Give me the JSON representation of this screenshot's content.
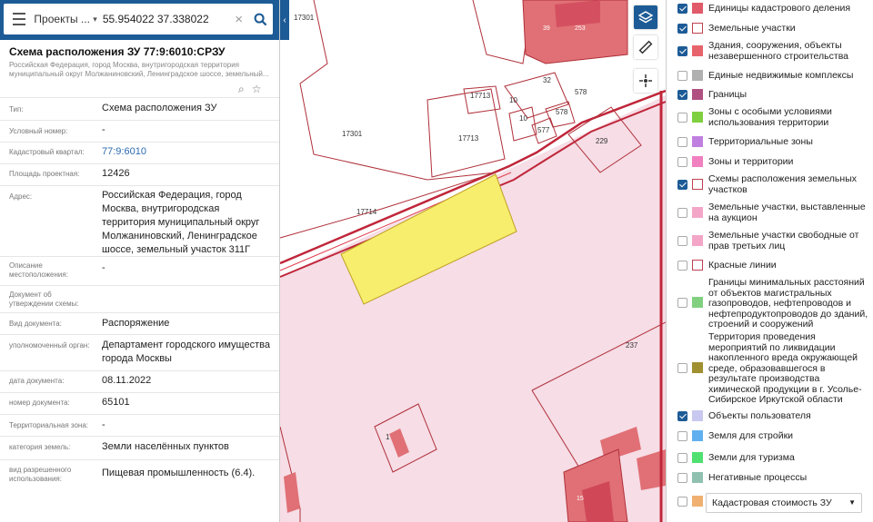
{
  "search": {
    "mode": "Проекты ...",
    "query": "55.954022 37.338022"
  },
  "card": {
    "title": "Схема расположения ЗУ 77:9:6010:СРЗУ",
    "address_sub": "Российская Федерация, город Москва, внутригородская территория муниципальный округ Молжаниновский, Ленинградское шоссе, земельный...",
    "rows": [
      {
        "label": "Тип:",
        "value": "Схема расположения ЗУ"
      },
      {
        "label": "Условный номер:",
        "value": "-"
      },
      {
        "label": "Кадастровый квартал:",
        "value": "77:9:6010"
      },
      {
        "label": "Площадь проектная:",
        "value": "12426"
      },
      {
        "label": "Адрес:",
        "value": "Российская Федерация, город Москва, внутригородская территория муниципальный округ Молжаниновский, Ленинградское шоссе, земельный участок 311Г"
      },
      {
        "label": "Описание местоположения:",
        "value": "-"
      },
      {
        "label": "Документ об утверждении схемы:",
        "value": ""
      },
      {
        "label": "Вид документа:",
        "value": "Распоряжение"
      },
      {
        "label": "уполномоченный орган:",
        "value": "Департамент городского имущества города Москвы"
      },
      {
        "label": "дата документа:",
        "value": "08.11.2022"
      },
      {
        "label": "номер документа:",
        "value": "65101"
      },
      {
        "label": "Территориальная зона:",
        "value": "-"
      },
      {
        "label": "категория земель:",
        "value": "Земли населённых пунктов"
      },
      {
        "label": "вид разрешенного использования:",
        "value": "Пищевая промышленность (6.4)."
      }
    ]
  },
  "map": {
    "parcel_labels": [
      "17301",
      "17301",
      "17713",
      "17713",
      "17714",
      "10",
      "10",
      "32",
      "577",
      "578",
      "578",
      "229",
      "237",
      "39",
      "253",
      "1",
      "15"
    ]
  },
  "layers": [
    {
      "label": "Единицы кадастрового деления",
      "checked": true,
      "swatch": "#e05a6a"
    },
    {
      "label": "Земельные участки",
      "checked": true,
      "swatch": "#ffffff"
    },
    {
      "label": "Здания, сооружения, объекты незавершенного строительства",
      "checked": true,
      "swatch": "#e8646c"
    },
    {
      "label": "Единые недвижимые комплексы",
      "checked": false,
      "swatch": "#b0b0b0"
    },
    {
      "label": "Границы",
      "checked": true,
      "swatch": "#b05080"
    },
    {
      "label": "Зоны с особыми условиями использования территории",
      "checked": false,
      "swatch": "#7fd040"
    },
    {
      "label": "Территориальные зоны",
      "checked": false,
      "swatch": "#c080e0"
    },
    {
      "label": "Зоны и территории",
      "checked": false,
      "swatch": "#f080c0"
    },
    {
      "label": "Схемы расположения земельных участков",
      "checked": true,
      "swatch": "#ffffff"
    },
    {
      "label": "Земельные участки, выставленные на аукцион",
      "checked": false,
      "swatch": "#f3a6c8"
    },
    {
      "label": "Земельные участки свободные от прав третьих лиц",
      "checked": false,
      "swatch": "#f3a6c8"
    },
    {
      "label": "Красные линии",
      "checked": false,
      "swatch": "#ffffff"
    },
    {
      "label": "Границы минимальных расстояний от объектов магистральных газопроводов, нефтепроводов и нефтепродуктопроводов до зданий, строений и сооружений",
      "checked": false,
      "swatch": "#80d080"
    },
    {
      "label": "Территория проведения мероприятий по ликвидации накопленного вреда окружающей среде, образовавшегося в результате производства химической продукции в г. Усолье-Сибирское Иркутской области",
      "checked": false,
      "swatch": "#a09030"
    },
    {
      "label": "Объекты пользователя",
      "checked": true,
      "swatch": "#c8c8f0"
    },
    {
      "label": "Земля для стройки",
      "checked": false,
      "swatch": "#60b0f0"
    },
    {
      "label": "Земли для туризма",
      "checked": false,
      "swatch": "#50e070"
    },
    {
      "label": "Негативные процессы",
      "checked": false,
      "swatch": "#90c0b0"
    },
    {
      "label": "Кадастровая стоимость ЗУ",
      "checked": false,
      "swatch": "#f0b070"
    }
  ]
}
